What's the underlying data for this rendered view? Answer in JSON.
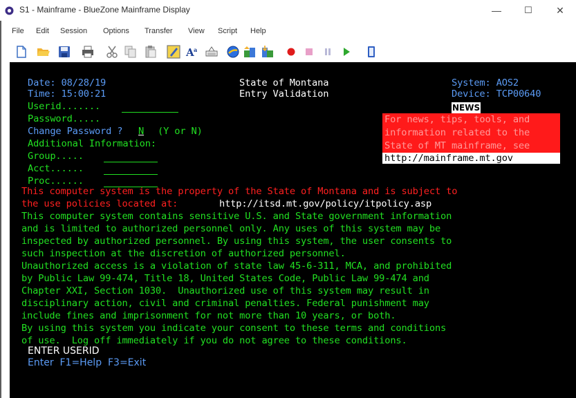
{
  "window": {
    "title": "S1 - Mainframe - BlueZone Mainframe Display",
    "controls": [
      "—",
      "☐",
      "✕"
    ]
  },
  "menu": [
    "File",
    "Edit",
    "Session",
    "Options",
    "Transfer",
    "View",
    "Script",
    "Help"
  ],
  "toolbar": [
    "new-document",
    "open-folder",
    "save",
    "print",
    "cut",
    "copy",
    "paste",
    "macro-editor",
    "font-size",
    "keyboard",
    "web-connect",
    "file-transfer-send",
    "file-transfer-receive",
    "record",
    "stop",
    "pause",
    "play",
    "clipboard"
  ],
  "terminal": {
    "date": "Date: 08/28/19",
    "time": "Time: 15:00:21",
    "header_line1": "State of Montana",
    "header_line2": "Entry Validation",
    "system": "System: AOS2",
    "device": "Device: TCP00640",
    "news_title": "NEWS",
    "news_lines": [
      "For news, tips, tools, and",
      "information related to the",
      "State of MT mainframe, see"
    ],
    "news_url": "http://mainframe.mt.gov",
    "userid_label": "Userid.......",
    "password_label": "Password.....",
    "change_pw_label": "Change Password ?",
    "change_pw_value": "N",
    "change_pw_hint": "(Y or N)",
    "additional_info": "Additional Information:",
    "group_label": "Group.....",
    "acct_label": "Acct......",
    "proc_label": "Proc......",
    "property_line1": "This computer system is the property of the State of Montana and is subject to",
    "property_line2_prefix": "the use policies located at:",
    "policy_url": "http://itsd.mt.gov/policy/itpolicy.asp",
    "notice_lines": [
      "This computer system contains sensitive U.S. and State government information",
      "and is limited to authorized personnel only. Any uses of this system may be",
      "inspected by authorized personnel. By using this system, the user consents to",
      "such inspection at the discretion of authorized personnel.",
      "Unauthorized access is a violation of state law 45-6-311, MCA, and prohibited",
      "by Public Law 99-474, Title 18, United States Code, Public Law 99-474 and",
      "Chapter XXI, Section 1030.  Unauthorized use of this system may result in",
      "disciplinary action, civil and criminal penalties. Federal punishment may",
      "include fines and imprisonment for not more than 10 years, or both.",
      "By using this system you indicate your consent to these terms and conditions",
      "of use.  Log off immediately if you do not agree to these conditions."
    ],
    "prompt": "ENTER USERID",
    "function_keys": "Enter  F1=Help  F3=Exit"
  },
  "colors": {
    "terminal_bg": "#000000",
    "protected_blue": "#5b9bf5",
    "input_green": "#22e022",
    "alert_red": "#ff2020"
  }
}
